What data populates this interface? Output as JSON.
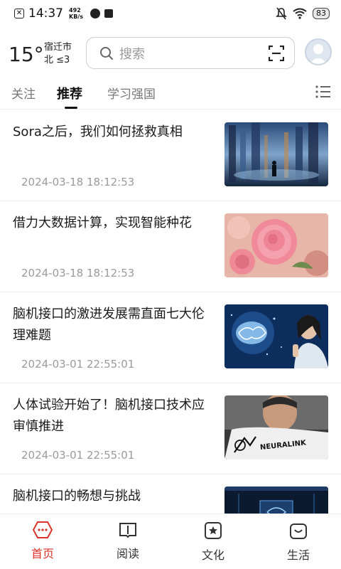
{
  "status_bar": {
    "time": "14:37",
    "speed_value": "492",
    "speed_unit": "KB/s",
    "battery": "83"
  },
  "header": {
    "temperature": "15°",
    "city": "宿迁市",
    "wind": "北 ≤3",
    "search_placeholder": "搜索"
  },
  "tabs": [
    {
      "label": "关注",
      "active": false
    },
    {
      "label": "推荐",
      "active": true
    },
    {
      "label": "学习强国",
      "active": false
    }
  ],
  "feed": [
    {
      "title": "Sora之后，我们如何拯救真相",
      "time": "2024-03-18 18:12:53",
      "image": "sora-city-image"
    },
    {
      "title": "借力大数据计算，实现智能种花",
      "time": "2024-03-18 18:12:53",
      "image": "pink-rose-image"
    },
    {
      "title": "脑机接口的激进发展需直面七大伦理难题",
      "time": "2024-03-01 22:55:01",
      "image": "brain-hologram-image"
    },
    {
      "title": "人体试验开始了！脑机接口技术应审慎推进",
      "time": "2024-03-01 22:55:01",
      "image": "neuralink-image",
      "image_text": "NEURALINK"
    },
    {
      "title": "脑机接口的畅想与挑战",
      "time": "",
      "image": "chip-image"
    }
  ],
  "bottom_nav": [
    {
      "label": "首页",
      "icon": "home-icon",
      "active": true
    },
    {
      "label": "阅读",
      "icon": "book-icon",
      "active": false
    },
    {
      "label": "文化",
      "icon": "star-box-icon",
      "active": false
    },
    {
      "label": "生活",
      "icon": "smile-bag-icon",
      "active": false
    }
  ],
  "colors": {
    "accent": "#d9342b",
    "muted_text": "#9a9a9a"
  }
}
